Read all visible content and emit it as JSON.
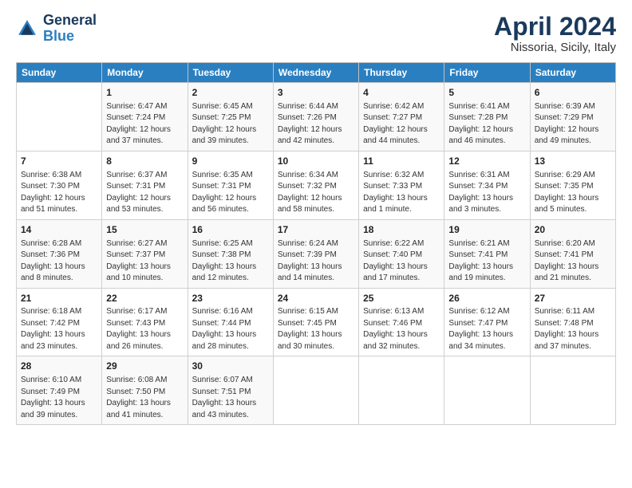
{
  "logo": {
    "line1": "General",
    "line2": "Blue"
  },
  "title": "April 2024",
  "subtitle": "Nissoria, Sicily, Italy",
  "days_header": [
    "Sunday",
    "Monday",
    "Tuesday",
    "Wednesday",
    "Thursday",
    "Friday",
    "Saturday"
  ],
  "weeks": [
    [
      {
        "num": "",
        "content": ""
      },
      {
        "num": "1",
        "content": "Sunrise: 6:47 AM\nSunset: 7:24 PM\nDaylight: 12 hours\nand 37 minutes."
      },
      {
        "num": "2",
        "content": "Sunrise: 6:45 AM\nSunset: 7:25 PM\nDaylight: 12 hours\nand 39 minutes."
      },
      {
        "num": "3",
        "content": "Sunrise: 6:44 AM\nSunset: 7:26 PM\nDaylight: 12 hours\nand 42 minutes."
      },
      {
        "num": "4",
        "content": "Sunrise: 6:42 AM\nSunset: 7:27 PM\nDaylight: 12 hours\nand 44 minutes."
      },
      {
        "num": "5",
        "content": "Sunrise: 6:41 AM\nSunset: 7:28 PM\nDaylight: 12 hours\nand 46 minutes."
      },
      {
        "num": "6",
        "content": "Sunrise: 6:39 AM\nSunset: 7:29 PM\nDaylight: 12 hours\nand 49 minutes."
      }
    ],
    [
      {
        "num": "7",
        "content": "Sunrise: 6:38 AM\nSunset: 7:30 PM\nDaylight: 12 hours\nand 51 minutes."
      },
      {
        "num": "8",
        "content": "Sunrise: 6:37 AM\nSunset: 7:31 PM\nDaylight: 12 hours\nand 53 minutes."
      },
      {
        "num": "9",
        "content": "Sunrise: 6:35 AM\nSunset: 7:31 PM\nDaylight: 12 hours\nand 56 minutes."
      },
      {
        "num": "10",
        "content": "Sunrise: 6:34 AM\nSunset: 7:32 PM\nDaylight: 12 hours\nand 58 minutes."
      },
      {
        "num": "11",
        "content": "Sunrise: 6:32 AM\nSunset: 7:33 PM\nDaylight: 13 hours\nand 1 minute."
      },
      {
        "num": "12",
        "content": "Sunrise: 6:31 AM\nSunset: 7:34 PM\nDaylight: 13 hours\nand 3 minutes."
      },
      {
        "num": "13",
        "content": "Sunrise: 6:29 AM\nSunset: 7:35 PM\nDaylight: 13 hours\nand 5 minutes."
      }
    ],
    [
      {
        "num": "14",
        "content": "Sunrise: 6:28 AM\nSunset: 7:36 PM\nDaylight: 13 hours\nand 8 minutes."
      },
      {
        "num": "15",
        "content": "Sunrise: 6:27 AM\nSunset: 7:37 PM\nDaylight: 13 hours\nand 10 minutes."
      },
      {
        "num": "16",
        "content": "Sunrise: 6:25 AM\nSunset: 7:38 PM\nDaylight: 13 hours\nand 12 minutes."
      },
      {
        "num": "17",
        "content": "Sunrise: 6:24 AM\nSunset: 7:39 PM\nDaylight: 13 hours\nand 14 minutes."
      },
      {
        "num": "18",
        "content": "Sunrise: 6:22 AM\nSunset: 7:40 PM\nDaylight: 13 hours\nand 17 minutes."
      },
      {
        "num": "19",
        "content": "Sunrise: 6:21 AM\nSunset: 7:41 PM\nDaylight: 13 hours\nand 19 minutes."
      },
      {
        "num": "20",
        "content": "Sunrise: 6:20 AM\nSunset: 7:41 PM\nDaylight: 13 hours\nand 21 minutes."
      }
    ],
    [
      {
        "num": "21",
        "content": "Sunrise: 6:18 AM\nSunset: 7:42 PM\nDaylight: 13 hours\nand 23 minutes."
      },
      {
        "num": "22",
        "content": "Sunrise: 6:17 AM\nSunset: 7:43 PM\nDaylight: 13 hours\nand 26 minutes."
      },
      {
        "num": "23",
        "content": "Sunrise: 6:16 AM\nSunset: 7:44 PM\nDaylight: 13 hours\nand 28 minutes."
      },
      {
        "num": "24",
        "content": "Sunrise: 6:15 AM\nSunset: 7:45 PM\nDaylight: 13 hours\nand 30 minutes."
      },
      {
        "num": "25",
        "content": "Sunrise: 6:13 AM\nSunset: 7:46 PM\nDaylight: 13 hours\nand 32 minutes."
      },
      {
        "num": "26",
        "content": "Sunrise: 6:12 AM\nSunset: 7:47 PM\nDaylight: 13 hours\nand 34 minutes."
      },
      {
        "num": "27",
        "content": "Sunrise: 6:11 AM\nSunset: 7:48 PM\nDaylight: 13 hours\nand 37 minutes."
      }
    ],
    [
      {
        "num": "28",
        "content": "Sunrise: 6:10 AM\nSunset: 7:49 PM\nDaylight: 13 hours\nand 39 minutes."
      },
      {
        "num": "29",
        "content": "Sunrise: 6:08 AM\nSunset: 7:50 PM\nDaylight: 13 hours\nand 41 minutes."
      },
      {
        "num": "30",
        "content": "Sunrise: 6:07 AM\nSunset: 7:51 PM\nDaylight: 13 hours\nand 43 minutes."
      },
      {
        "num": "",
        "content": ""
      },
      {
        "num": "",
        "content": ""
      },
      {
        "num": "",
        "content": ""
      },
      {
        "num": "",
        "content": ""
      }
    ]
  ]
}
